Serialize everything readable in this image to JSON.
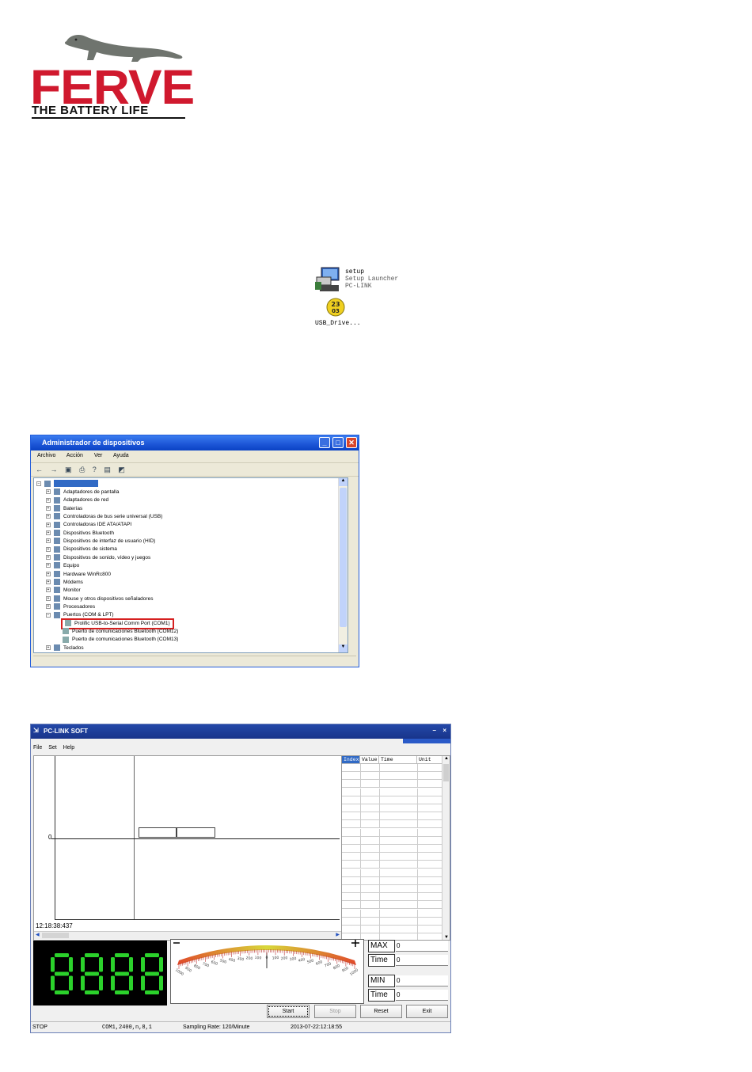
{
  "logo": {
    "brand": "FERVE",
    "tagline": "THE BATTERY LIFE",
    "brand_color": "#d0192e"
  },
  "setup_files": {
    "setup": {
      "name": "setup",
      "desc": "Setup Launcher",
      "product": "PC-LINK"
    },
    "driver": {
      "name": "USB_Drive..."
    }
  },
  "device_manager": {
    "title": "Administrador de dispositivos",
    "menu": [
      "Archivo",
      "Acción",
      "Ver",
      "Ayuda"
    ],
    "tree": [
      "Adaptadores de pantalla",
      "Adaptadores de red",
      "Baterías",
      "Controladoras de bus serie universal (USB)",
      "Controladoras IDE ATA/ATAPI",
      "Dispositivos Bluetooth",
      "Dispositivos de interfaz de usuario (HID)",
      "Dispositivos de sistema",
      "Dispositivos de sonido, vídeo y juegos",
      "Equipo",
      "Hardware WinRc800",
      "Módems",
      "Monitor",
      "Mouse y otros dispositivos señaladores",
      "Procesadores",
      "Puertos (COM & LPT)"
    ],
    "ports": [
      "Prolific USB-to-Serial Comm Port (COM1)",
      "Puerto de comunicaciones Bluetooth (COM12)",
      "Puerto de comunicaciones Bluetooth (COM13)"
    ],
    "last_item": "Teclados",
    "highlight_color": "#d62020"
  },
  "pclink": {
    "title": "PC-LINK SOFT",
    "menu": [
      "File",
      "Set",
      "Help"
    ],
    "table_headers": [
      "Index",
      "Value",
      "Time",
      "Unit"
    ],
    "plot_y_label": "0",
    "plot_time": "12:18:38:437",
    "lcd_text": "8888",
    "lcd_color": "#2bd22b",
    "gauge_ticks": [
      "1000",
      "900",
      "800",
      "700",
      "600",
      "500",
      "400",
      "300",
      "200",
      "100",
      "0",
      "100",
      "200",
      "300",
      "400",
      "500",
      "600",
      "700",
      "800",
      "900",
      "1000"
    ],
    "max_label": "MAX",
    "max_value": "0",
    "max_time_label": "Time",
    "max_time_value": "0",
    "min_label": "MIN",
    "min_value": "0",
    "min_time_label": "Time",
    "min_time_value": "0",
    "buttons": {
      "start": "Start",
      "stop": "Stop",
      "reset": "Reset",
      "exit": "Exit"
    },
    "status": {
      "state": "STOP",
      "port": "COM1,2400,n,8,1",
      "rate": "Sampling Rate: 120/Minute",
      "datetime": "2013-07-22:12:18:55"
    }
  }
}
